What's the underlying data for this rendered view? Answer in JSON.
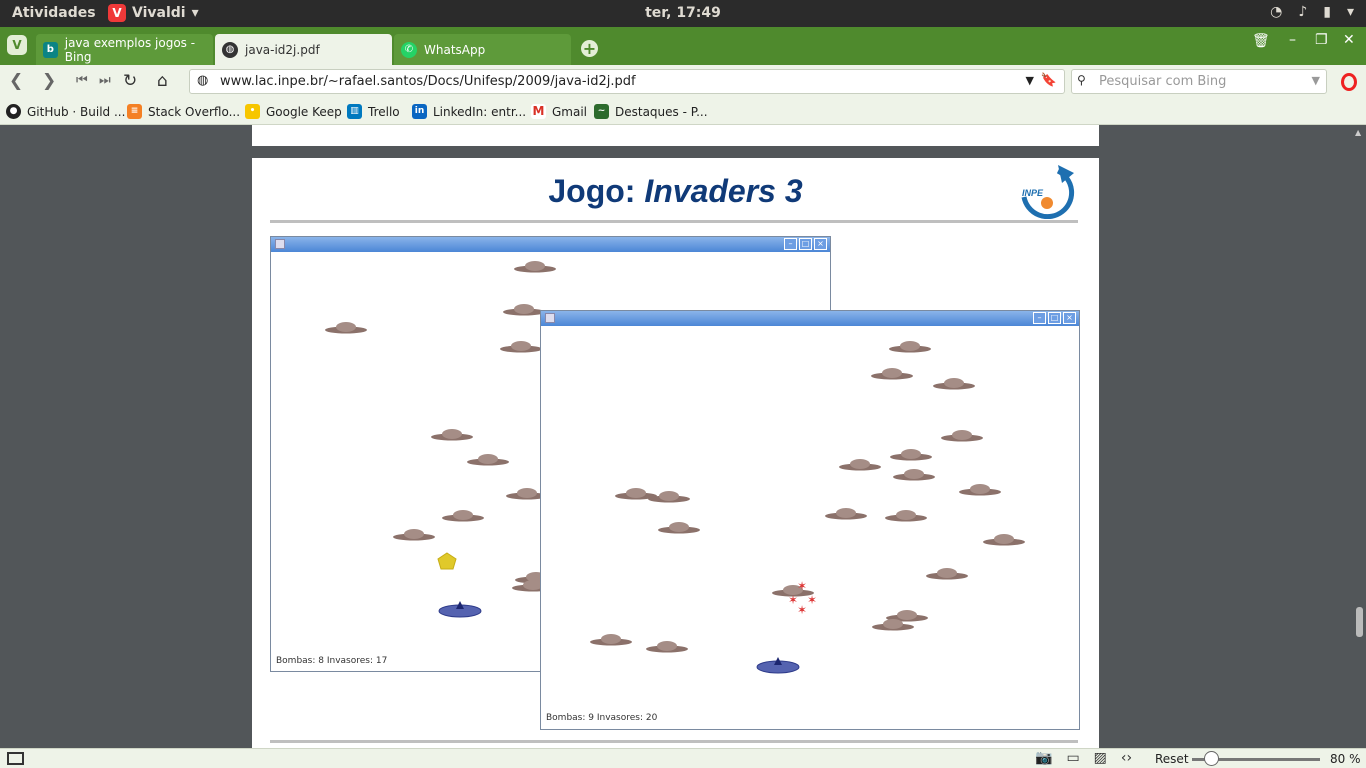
{
  "system": {
    "activities": "Atividades",
    "app_name": "Vivaldi",
    "clock": "ter, 17:49"
  },
  "tabs": [
    {
      "label": "java exemplos jogos - Bing",
      "icon": "bing-icon",
      "state": "inactive"
    },
    {
      "label": "java-id2j.pdf",
      "icon": "globe-icon",
      "state": "active"
    },
    {
      "label": "WhatsApp",
      "icon": "whatsapp-icon",
      "state": "inactive"
    }
  ],
  "address": {
    "url": "www.lac.inpe.br/~rafael.santos/Docs/Unifesp/2009/java-id2j.pdf",
    "search_placeholder": "Pesquisar com Bing"
  },
  "bookmarks": [
    {
      "label": "GitHub · Build ...",
      "icon": "github-icon",
      "color": "#222222"
    },
    {
      "label": "Stack Overflo...",
      "icon": "stackoverflow-icon",
      "color": "#f48024"
    },
    {
      "label": "Google Keep",
      "icon": "keep-icon",
      "color": "#f7c600"
    },
    {
      "label": "Trello",
      "icon": "trello-icon",
      "color": "#0079bf"
    },
    {
      "label": "LinkedIn: entr...",
      "icon": "linkedin-icon",
      "color": "#0a66c2"
    },
    {
      "label": "Gmail",
      "icon": "gmail-icon",
      "color": "#d93025"
    },
    {
      "label": "Destaques - P...",
      "icon": "destaques-icon",
      "color": "#2d6b2d"
    }
  ],
  "slide": {
    "title_prefix": "Jogo: ",
    "title_italic": "Invaders 3",
    "logo_text": "INPE"
  },
  "game_windows": [
    {
      "status": "Bombas: 8 Invasores: 17"
    },
    {
      "status": "Bombas: 9 Invasores: 20"
    }
  ],
  "statusbar": {
    "reset_label": "Reset",
    "zoom": "80 %"
  },
  "colors": {
    "tabbar": "#4f8a2d",
    "toolbar": "#eef3e8",
    "title_blue": "#103a78",
    "invader": "#9a7f78",
    "ship": "#4a5aa8"
  }
}
